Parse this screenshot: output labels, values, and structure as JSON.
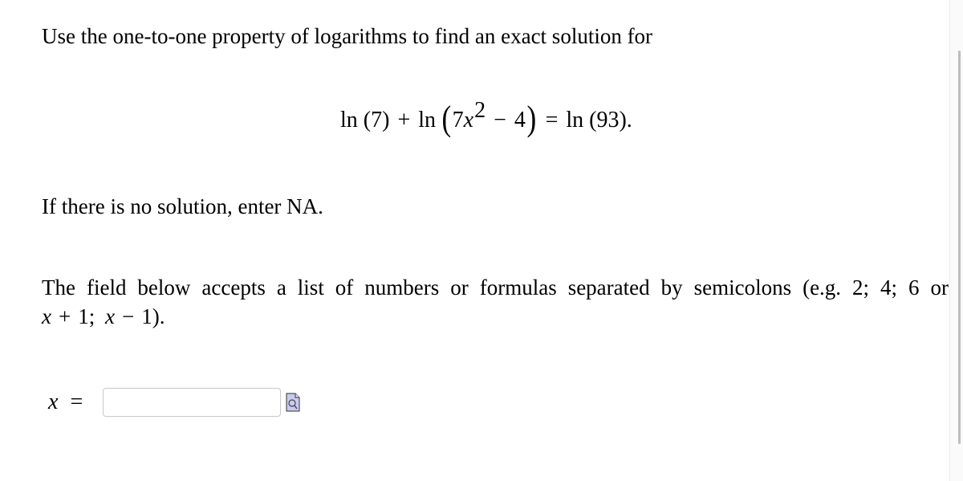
{
  "problem": {
    "intro": "Use the one-to-one property of logarithms to find an exact solution for",
    "equation": {
      "term1_fn": "ln",
      "term1_arg": "(7)",
      "plus": "+",
      "term2_fn": "ln",
      "term2_coef": "7",
      "term2_var": "x",
      "term2_exp": "2",
      "minus": "−",
      "term2_const": "4",
      "equals": "=",
      "rhs_fn": "ln",
      "rhs_arg": "(93)",
      "end": "."
    },
    "no_solution_note": "If there is no solution, enter NA.",
    "instructions": "The field below accepts a list of numbers or formulas separated by semicolons (e.g. 2; 4; 6 or",
    "instructions_example": {
      "var1": "x",
      "op1": "+",
      "num1": "1;",
      "var2": "x",
      "op2": "−",
      "num2": "1)."
    }
  },
  "answer": {
    "label_var": "x",
    "label_eq": "=",
    "value": "",
    "placeholder": "",
    "preview_icon": "document-magnifier-icon"
  }
}
